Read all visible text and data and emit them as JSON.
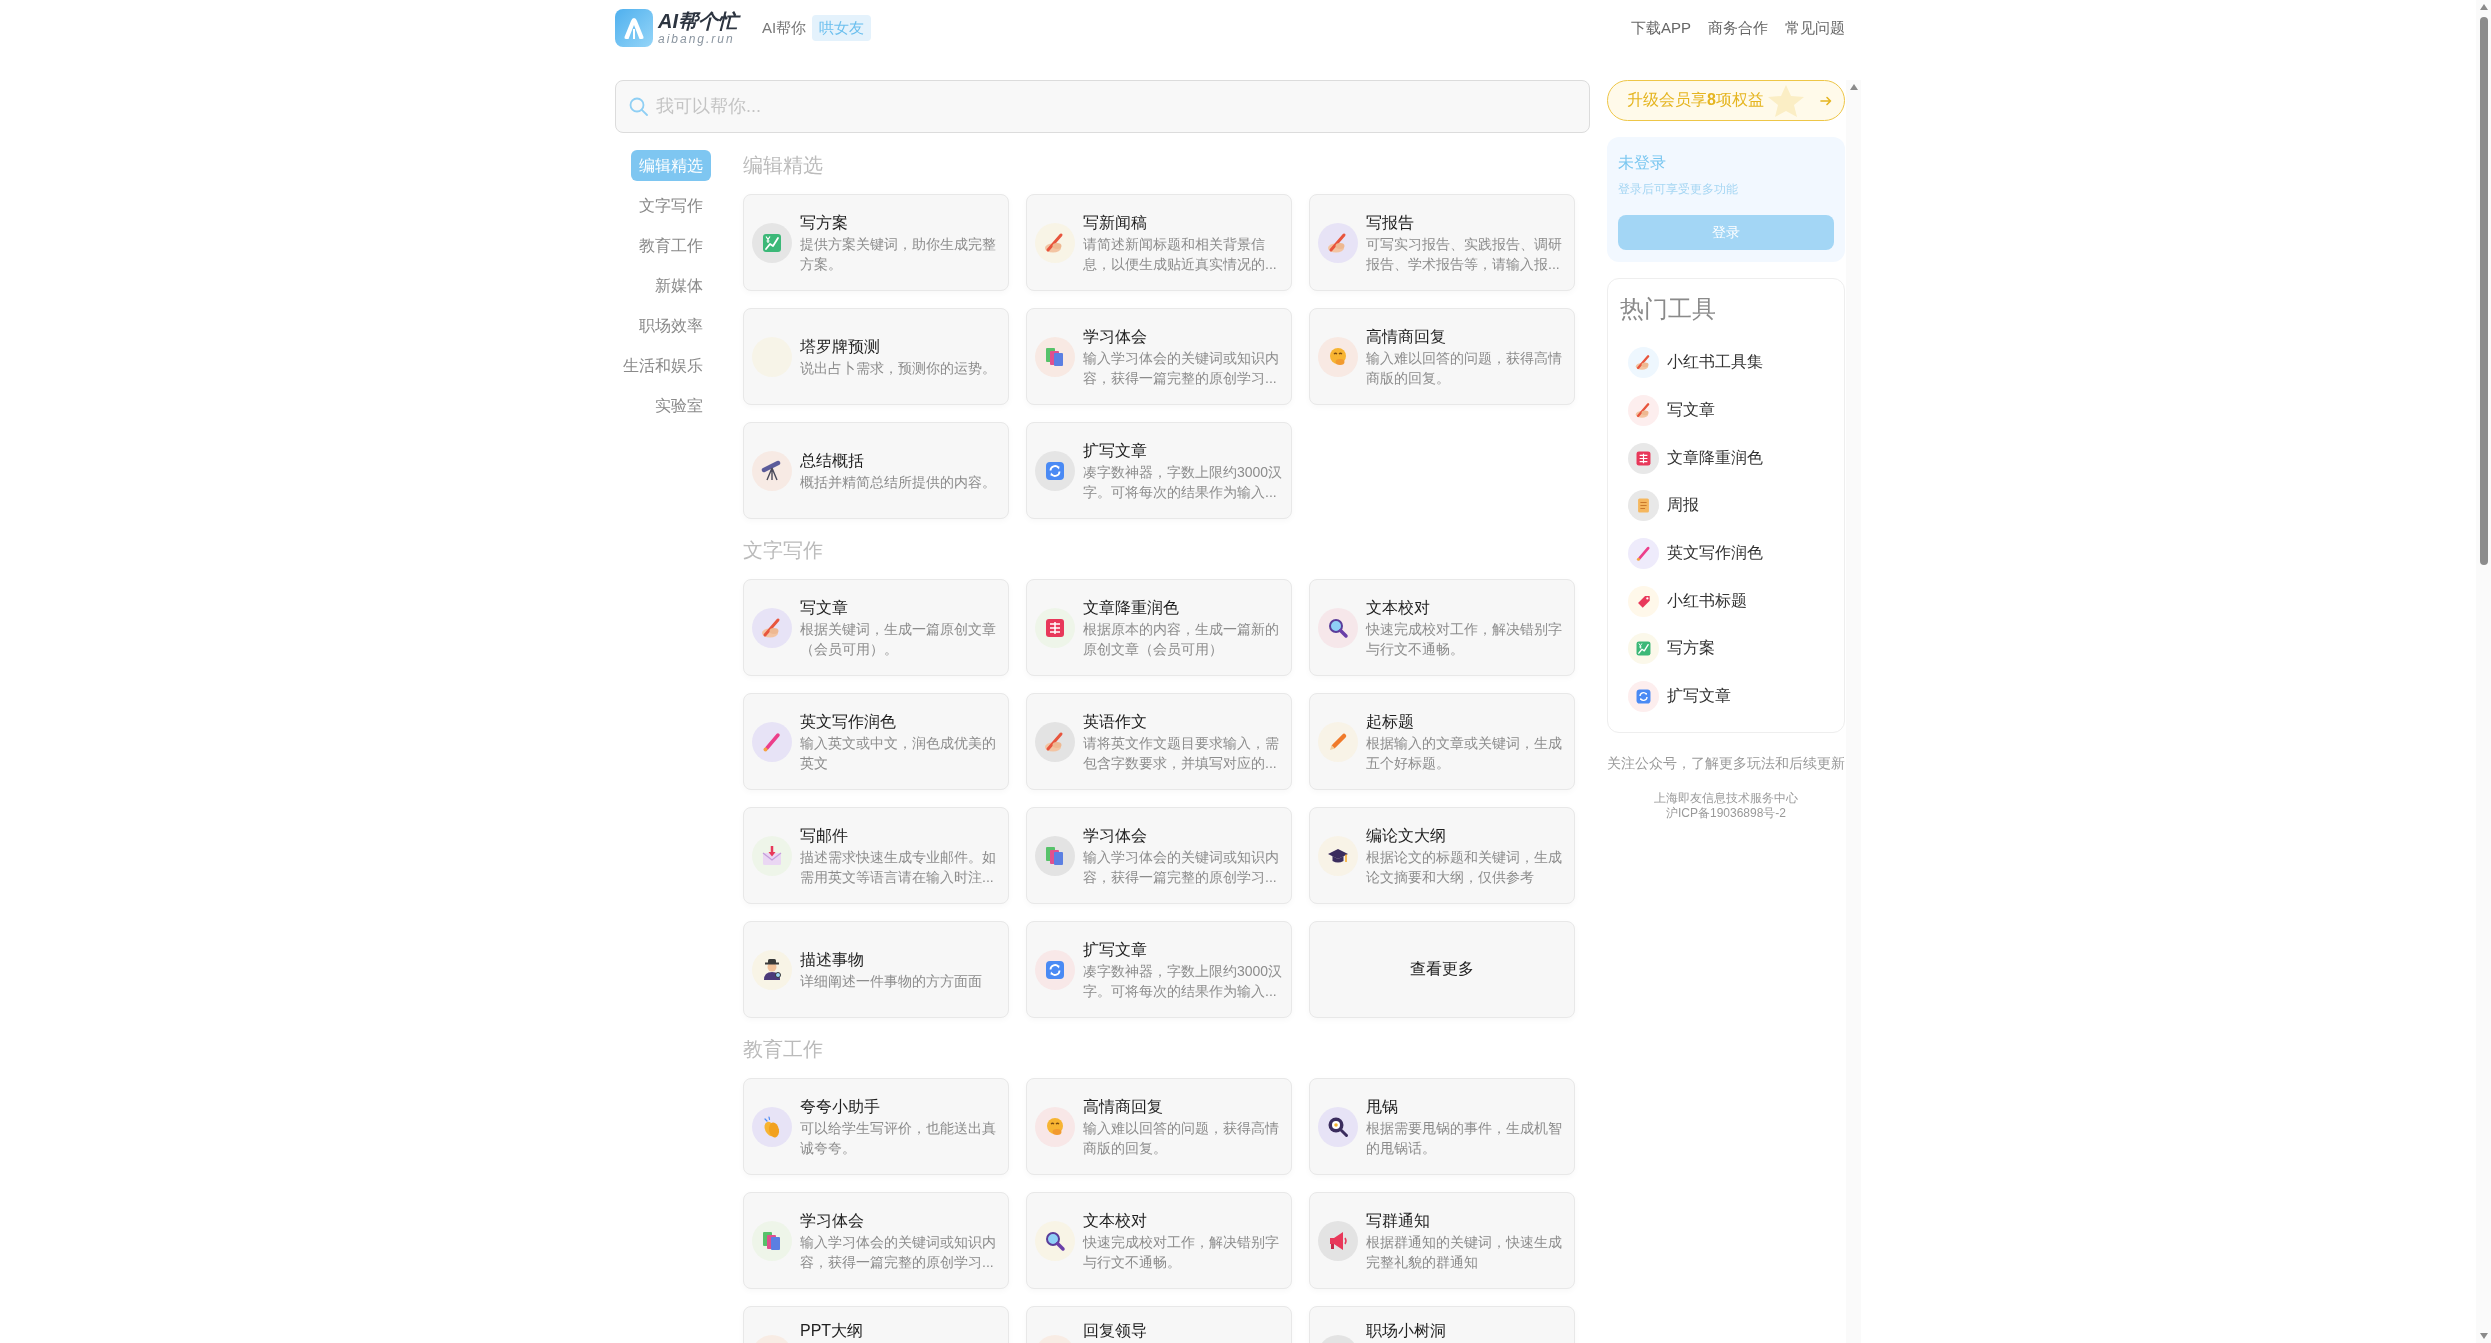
{
  "header": {
    "logo": {
      "name": "AI帮个忙",
      "domain": "aibang.run"
    },
    "tagline": "AI帮你",
    "tag": "哄女友",
    "links": [
      "下载APP",
      "商务合作",
      "常见问题"
    ]
  },
  "search": {
    "placeholder": "我可以帮你..."
  },
  "nav": {
    "items": [
      {
        "label": "编辑精选",
        "selected": true
      },
      {
        "label": "文字写作",
        "selected": false
      },
      {
        "label": "教育工作",
        "selected": false
      },
      {
        "label": "新媒体",
        "selected": false
      },
      {
        "label": "职场效率",
        "selected": false
      },
      {
        "label": "生活和娱乐",
        "selected": false
      },
      {
        "label": "实验室",
        "selected": false
      }
    ]
  },
  "sections": [
    {
      "title": "编辑精选",
      "cards": [
        {
          "kind": "chart",
          "color": "#e5e5e5",
          "title": "写方案",
          "desc": "提供方案关键词，助你生成完整方案。"
        },
        {
          "kind": "pen",
          "color": "#f8f4e6",
          "title": "写新闻稿",
          "desc": "请简述新闻标题和相关背景信息，以便生成贴近真实情况的..."
        },
        {
          "kind": "pen",
          "color": "#e7e3f6",
          "title": "写报告",
          "desc": "可写实习报告、实践报告、调研报告、学术报告等，请输入报..."
        },
        {
          "kind": "blank",
          "color": "#f7f4e8",
          "title": "塔罗牌预测",
          "desc": "说出占卜需求，预测你的运势。"
        },
        {
          "kind": "books",
          "color": "#f8e9e3",
          "title": "学习体会",
          "desc": "输入学习体会的关键词或知识内容，获得一篇完整的原创学习..."
        },
        {
          "kind": "smiley",
          "color": "#f8e9e3",
          "title": "高情商回复",
          "desc": "输入难以回答的问题，获得高情商版的回复。"
        },
        {
          "kind": "telescope",
          "color": "#f7eae4",
          "title": "总结概括",
          "desc": "概括并精简总结所提供的内容。"
        },
        {
          "kind": "refresh",
          "color": "#e5e5e5",
          "title": "扩写文章",
          "desc": "凑字数神器，字数上限约3000汉字。可将每次的结果作为输入..."
        }
      ]
    },
    {
      "title": "文字写作",
      "cards": [
        {
          "kind": "pen",
          "color": "#e7e3f6",
          "title": "写文章",
          "desc": "根据关键词，生成一篇原创文章（会员可用）。"
        },
        {
          "kind": "stamp",
          "color": "#eef5e9",
          "title": "文章降重润色",
          "desc": "根据原本的内容，生成一篇新的原创文章（会员可用）"
        },
        {
          "kind": "magnifier",
          "color": "#f6e7ea",
          "title": "文本校对",
          "desc": "快速完成校对工作，解决错别字与行文不通畅。"
        },
        {
          "kind": "brush",
          "color": "#e7e3f6",
          "title": "英文写作润色",
          "desc": "输入英文或中文，润色成优美的英文"
        },
        {
          "kind": "pen",
          "color": "#e3e3e3",
          "title": "英语作文",
          "desc": "请将英文作文题目要求输入，需包含字数要求，并填写对应的..."
        },
        {
          "kind": "pencil",
          "color": "#f8f3e7",
          "title": "起标题",
          "desc": "根据输入的文章或关键词，生成五个好标题。"
        },
        {
          "kind": "envelope",
          "color": "#eef5e9",
          "title": "写邮件",
          "desc": "描述需求快速生成专业邮件。如需用英文等语言请在输入时注..."
        },
        {
          "kind": "books",
          "color": "#e3e3e3",
          "title": "学习体会",
          "desc": "输入学习体会的关键词或知识内容，获得一篇完整的原创学习..."
        },
        {
          "kind": "cap",
          "color": "#f8f3e7",
          "title": "编论文大纲",
          "desc": "根据论文的标题和关键词，生成论文摘要和大纲，仅供参考"
        },
        {
          "kind": "detective",
          "color": "#f8f4e6",
          "title": "描述事物",
          "desc": "详细阐述一件事物的方方面面"
        },
        {
          "kind": "refresh",
          "color": "#f8e8e8",
          "title": "扩写文章",
          "desc": "凑字数神器，字数上限约3000汉字。可将每次的结果作为输入..."
        },
        {
          "kind": "more",
          "title": "查看更多"
        }
      ]
    },
    {
      "title": "教育工作",
      "cards": [
        {
          "kind": "clap",
          "color": "#e7e3f6",
          "title": "夸夸小助手",
          "desc": "可以给学生写评价，也能送出真诚夸夸。"
        },
        {
          "kind": "smiley",
          "color": "#f8e7e7",
          "title": "高情商回复",
          "desc": "输入难以回答的问题，获得高情商版的回复。"
        },
        {
          "kind": "pan",
          "color": "#e7e3f6",
          "title": "甩锅",
          "desc": "根据需要甩锅的事件，生成机智的甩锅话。"
        },
        {
          "kind": "books",
          "color": "#eef5e9",
          "title": "学习体会",
          "desc": "输入学习体会的关键词或知识内容，获得一篇完整的原创学习..."
        },
        {
          "kind": "magnifier",
          "color": "#f8f4e6",
          "title": "文本校对",
          "desc": "快速完成校对工作，解决错别字与行文不通畅。"
        },
        {
          "kind": "megaphone",
          "color": "#e3e3e3",
          "title": "写群通知",
          "desc": "根据群通知的关键词，快速生成完整礼貌的群通知"
        },
        {
          "kind": "blank",
          "color": "#f8ece4",
          "title": "PPT大纲"
        },
        {
          "kind": "blank",
          "color": "#f8ece4",
          "title": "回复领导"
        },
        {
          "kind": "blank",
          "color": "#e3e3e3",
          "title": "职场小树洞"
        }
      ]
    }
  ],
  "sidebar": {
    "upgrade": "升级会员享**8**项权益",
    "login": {
      "status": "未登录",
      "hint": "登录后可享受更多功能",
      "button": "登录"
    },
    "hot_tools": {
      "title": "热门工具",
      "items": [
        {
          "kind": "pen",
          "color": "#eef7fe",
          "label": "小红书工具集"
        },
        {
          "kind": "pen",
          "color": "#fdeeee",
          "label": "写文章"
        },
        {
          "kind": "stamp",
          "color": "#e8e8e8",
          "label": "文章降重润色"
        },
        {
          "kind": "scroll",
          "color": "#e8e8e8",
          "label": "周报"
        },
        {
          "kind": "brush",
          "color": "#eeebfb",
          "label": "英文写作润色"
        },
        {
          "kind": "tag",
          "color": "#fff8ea",
          "label": "小红书标题"
        },
        {
          "kind": "chart",
          "color": "#fbf8ea",
          "label": "写方案"
        },
        {
          "kind": "refresh",
          "color": "#fdeeee",
          "label": "扩写文章"
        }
      ]
    },
    "footer": {
      "follow": "关注公众号，了解更多玩法和后续更新",
      "company": "上海即友信息技术服务中心",
      "icp": "沪ICP备19036898号-2"
    }
  }
}
